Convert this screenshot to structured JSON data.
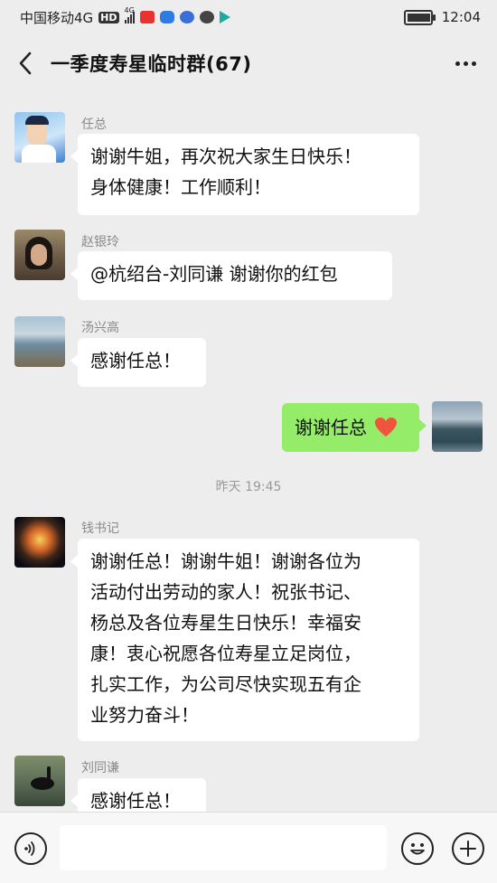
{
  "status_bar": {
    "carrier": "中国移动4G",
    "hd_badge": "HD",
    "net": "4G",
    "time": "12:04",
    "battery_level": 0.9,
    "colors": {
      "toutiao": "#e8322d",
      "app_blue": "#2d7be3",
      "wechat_green": "#1aad19"
    }
  },
  "header": {
    "title": "一季度寿星临时群(67)"
  },
  "messages": [
    {
      "sender": "任总",
      "lines": [
        "谢谢牛姐，再次祝大家生日快乐！",
        "身体健康！工作顺利！"
      ]
    },
    {
      "sender": "赵银玲",
      "lines": [
        "@杭绍台-刘同谦 谢谢你的红包"
      ]
    },
    {
      "sender": "汤兴高",
      "lines": [
        "感谢任总！"
      ]
    },
    {
      "sender": "",
      "lines": [
        "谢谢任总"
      ],
      "emoji": "heart-icon",
      "outgoing": true
    },
    {
      "sender": "钱书记",
      "lines": [
        "谢谢任总！谢谢牛姐！谢谢各位为",
        "活动付出劳动的家人！祝张书记、",
        "杨总及各位寿星生日快乐！幸福安",
        "康！衷心祝愿各位寿星立足岗位，",
        "扎实工作，为公司尽快实现五有企",
        "业努力奋斗！"
      ]
    },
    {
      "sender": "刘同谦",
      "lines": [
        "感谢任总！"
      ]
    }
  ],
  "timestamp": "昨天 19:45",
  "colors": {
    "bubble_outgoing": "#95ec69",
    "bubble_incoming": "#ffffff",
    "background": "#ededed",
    "heart": "#f0543c"
  }
}
